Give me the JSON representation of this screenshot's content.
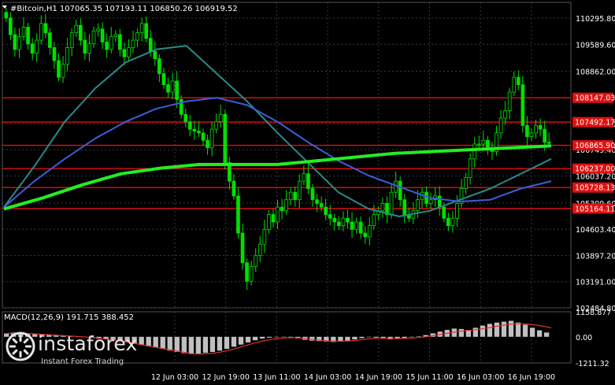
{
  "instrument": "#Bitcoin,H1",
  "ohlc": "107065.35 107193.11 106850.26 106919.52",
  "macd_label": "MACD(12,26,9) 191.715 388.452",
  "logo": {
    "name": "instaforex",
    "tagline": "Instant Forex Trading"
  },
  "colors": {
    "background": "#000000",
    "grid": "#3a3a3a",
    "candle": "#00e000",
    "ma_fast": "#2a8a8a",
    "ma_mid": "#3a5fd8",
    "ma_slow": "#22ee22",
    "level_line": "#e01010",
    "macd_hist": "#c0c0c0",
    "macd_signal": "#e03030"
  },
  "chart_data": [
    {
      "type": "candlestick",
      "title": "#Bitcoin,H1 107065.35 107193.11 106850.26 106919.52",
      "x_labels": [
        "12 Jun 03:00",
        "12 Jun 19:00",
        "13 Jun 11:00",
        "14 Jun 03:00",
        "14 Jun 19:00",
        "15 Jun 11:00",
        "16 Jun 03:00",
        "16 Jun 19:00"
      ],
      "y_ticks": [
        110295.8,
        109589.6,
        108862.0,
        107455.6,
        106749.4,
        106037.2,
        105309.6,
        104603.4,
        103897.2,
        103191.0,
        102484.8
      ],
      "ylim": [
        102484.8,
        110720
      ],
      "price_levels": [
        {
          "label": "108147.03",
          "value": 108147.03
        },
        {
          "label": "107492.17",
          "value": 107492.17
        },
        {
          "label": "106865.90",
          "value": 106865.9
        },
        {
          "label": "106237.00",
          "value": 106237.0
        },
        {
          "label": "105728.13",
          "value": 105728.13
        },
        {
          "label": "105164.11",
          "value": 105164.11
        }
      ],
      "close_series": [
        110300,
        109850,
        109450,
        109800,
        110050,
        109600,
        109350,
        109700,
        110150,
        109900,
        109500,
        109150,
        108700,
        109050,
        109500,
        109900,
        110100,
        109700,
        109350,
        109600,
        109950,
        110000,
        109650,
        109450,
        109800,
        109850,
        109450,
        109250,
        109500,
        109700,
        109900,
        110150,
        109750,
        109400,
        109200,
        108800,
        108500,
        108300,
        108600,
        108100,
        107700,
        107500,
        107300,
        107250,
        107200,
        107000,
        106800,
        107300,
        107500,
        107700,
        106400,
        105900,
        105500,
        104500,
        103700,
        103200,
        103600,
        103900,
        104200,
        104600,
        105000,
        104800,
        105200,
        105100,
        105400,
        105600,
        105400,
        105900,
        106100,
        105700,
        105400,
        105300,
        105200,
        105000,
        104900,
        104800,
        104700,
        104900,
        104800,
        104600,
        104800,
        104500,
        104400,
        104700,
        105000,
        105100,
        105300,
        105000,
        105600,
        105900,
        105400,
        105000,
        104900,
        105100,
        105400,
        105600,
        105300,
        105400,
        105500,
        105200,
        104900,
        104700,
        104900,
        105300,
        105700,
        106000,
        106500,
        106900,
        106900,
        107000,
        106800,
        106700,
        107200,
        107600,
        107800,
        108300,
        108700,
        108500,
        107400,
        107100,
        107200,
        107400,
        107300,
        106950,
        106920
      ],
      "moving_averages": [
        {
          "name": "MA fast",
          "color": "#2a8a8a",
          "values": [
            105200,
            106300,
            107500,
            108400,
            109100,
            109450,
            109550,
            108800,
            108050,
            107200,
            106400,
            105600,
            105150,
            104950,
            105100,
            105400,
            105700,
            106100,
            106500
          ]
        },
        {
          "name": "MA mid",
          "color": "#3a5fd8",
          "values": [
            105200,
            105900,
            106500,
            107050,
            107500,
            107850,
            108050,
            108150,
            107950,
            107500,
            106950,
            106450,
            106050,
            105750,
            105450,
            105350,
            105400,
            105700,
            105900
          ]
        },
        {
          "name": "MA slow",
          "color": "#22ee22",
          "values": [
            105150,
            105450,
            105800,
            106100,
            106250,
            106350,
            106350,
            106350,
            106450,
            106550,
            106650,
            106700,
            106750,
            106800,
            106850
          ]
        }
      ]
    },
    {
      "type": "bar",
      "title": "MACD(12,26,9) 191.715 388.452",
      "y_ticks": [
        1158.877,
        0.0,
        -1211.32
      ],
      "ylim": [
        -1211.32,
        1158.877
      ],
      "histogram": [
        150,
        200,
        180,
        160,
        140,
        120,
        100,
        80,
        60,
        40,
        20,
        -20,
        -60,
        -90,
        -120,
        -150,
        -200,
        -260,
        -320,
        -380,
        -440,
        -500,
        -560,
        -640,
        -700,
        -760,
        -800,
        -780,
        -740,
        -700,
        -640,
        -560,
        -460,
        -360,
        -260,
        -160,
        -80,
        -40,
        -20,
        -10,
        -30,
        -80,
        -140,
        -180,
        -200,
        -220,
        -240,
        -220,
        -180,
        -120,
        -60,
        -20,
        -40,
        -80,
        -120,
        -90,
        -60,
        -20,
        20,
        80,
        160,
        240,
        320,
        380,
        360,
        320,
        420,
        520,
        600,
        660,
        700,
        740,
        660,
        560,
        420,
        300,
        200
      ],
      "signal": [
        150,
        160,
        160,
        150,
        140,
        120,
        100,
        80,
        60,
        40,
        20,
        0,
        -20,
        -60,
        -100,
        -140,
        -180,
        -240,
        -300,
        -360,
        -420,
        -480,
        -540,
        -600,
        -660,
        -720,
        -780,
        -800,
        -790,
        -760,
        -710,
        -640,
        -560,
        -460,
        -360,
        -270,
        -190,
        -130,
        -80,
        -50,
        -40,
        -60,
        -90,
        -130,
        -160,
        -185,
        -200,
        -205,
        -190,
        -160,
        -120,
        -90,
        -70,
        -70,
        -80,
        -80,
        -70,
        -50,
        -20,
        20,
        70,
        130,
        190,
        240,
        280,
        310,
        350,
        400,
        460,
        520,
        570,
        600,
        600,
        580,
        540,
        480,
        420
      ]
    }
  ]
}
